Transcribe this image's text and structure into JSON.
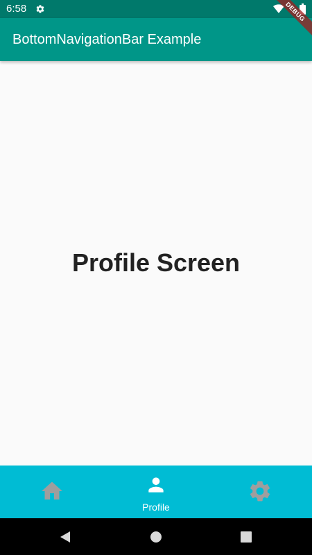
{
  "status_bar": {
    "time": "6:58",
    "icons": [
      "settings-icon",
      "wifi-icon",
      "battery-icon"
    ]
  },
  "debug_banner": {
    "label": "DEBUG"
  },
  "app_bar": {
    "title": "BottomNavigationBar Example"
  },
  "main": {
    "title": "Profile Screen"
  },
  "bottom_nav": {
    "background": "#00bcd4",
    "active_color": "#ffffff",
    "inactive_color": "#9e9e9e",
    "items": [
      {
        "icon": "home-icon",
        "label": "",
        "active": false
      },
      {
        "icon": "person-icon",
        "label": "Profile",
        "active": true
      },
      {
        "icon": "settings-icon",
        "label": "",
        "active": false
      }
    ]
  },
  "system_nav": {
    "buttons": [
      "back-icon",
      "home-circle-icon",
      "recents-icon"
    ]
  },
  "colors": {
    "status_bar": "#00796b",
    "app_bar": "#009688",
    "background": "#fafafa"
  }
}
